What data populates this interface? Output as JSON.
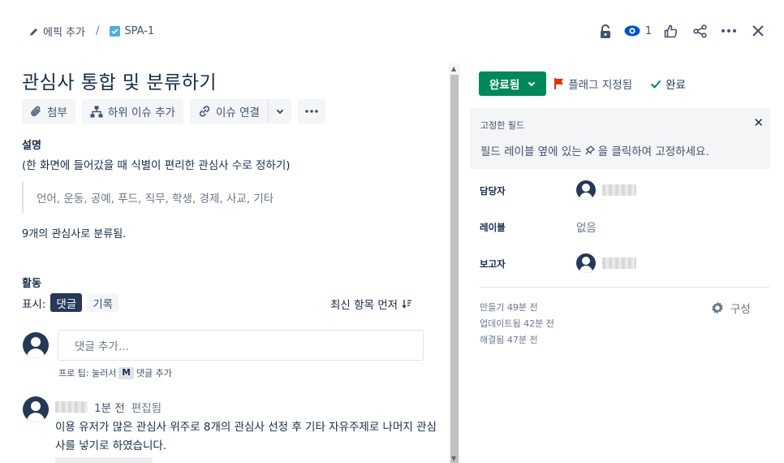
{
  "breadcrumb": {
    "epic_add": "에픽 추가",
    "separator": "/",
    "issue_key": "SPA-1"
  },
  "header_actions": {
    "watch_count": "1"
  },
  "issue": {
    "title": "관심사 통합 및 분류하기"
  },
  "toolbar": {
    "attach": "첨부",
    "add_child": "하위 이슈 추가",
    "link_issue": "이슈 연결"
  },
  "description": {
    "heading": "설명",
    "text": "(한 화면에 들어갔을 때 식별이 편리한 관심사 수로 정하기)",
    "quote": "언어, 운동, 공예, 푸드, 직무, 학생, 경제, 사교, 기타",
    "result": "9개의 관심사로 분류됨."
  },
  "activity": {
    "heading": "활동",
    "show_label": "표시:",
    "filters": [
      "댓글",
      "기록"
    ],
    "sort_label": "최신 항목 먼저",
    "comment_placeholder": "댓글 추가...",
    "tip_prefix": "프로 팁: 눌러서",
    "tip_key": "M",
    "tip_suffix": "댓글 추가",
    "comment": {
      "time": "1분 전",
      "edited": "편집됨",
      "text": "이용 유저가 많은 관심사 위주로 8개의 관심사 선정 후 기타 자유주제로 나머지 관심사를 넣기로 하였습니다."
    }
  },
  "status": {
    "current": "완료됨",
    "flag": "플래그 지정됨",
    "done": "완료",
    "accent": "#00875a"
  },
  "pinned": {
    "title": "고정한 필드",
    "message_pre": "필드 레이블 옆에 있는",
    "message_post": "을 클릭하여 고정하세요."
  },
  "fields": {
    "assignee_label": "담당자",
    "labels_label": "레이블",
    "labels_value": "없음",
    "reporter_label": "보고자"
  },
  "meta": {
    "created": "만들기 49분 전",
    "updated": "업데이트됨 42분 전",
    "resolved": "해결됨 47분 전",
    "configure": "구성"
  }
}
